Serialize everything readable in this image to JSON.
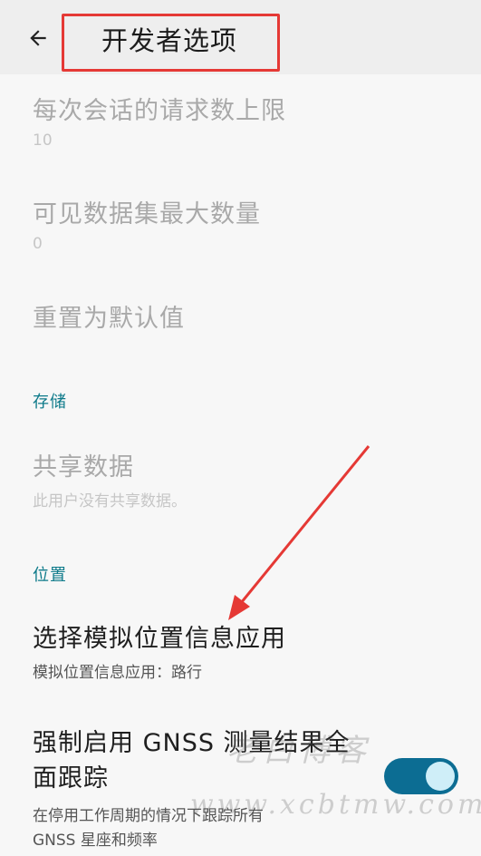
{
  "appbar": {
    "title": "开发者选项",
    "back_icon": "arrow-back-icon"
  },
  "items": {
    "max_requests": {
      "title": "每次会话的请求数上限",
      "summary": "10"
    },
    "max_datasets": {
      "title": "可见数据集最大数量",
      "summary": "0"
    },
    "reset_defaults": {
      "title": "重置为默认值"
    },
    "storage_category": "存储",
    "shared_data": {
      "title": "共享数据",
      "summary": "此用户没有共享数据。"
    },
    "location_category": "位置",
    "mock_location": {
      "title": "选择模拟位置信息应用",
      "summary": "模拟位置信息应用：路行"
    },
    "gnss": {
      "title_line1": "强制启用 GNSS 测量结果全",
      "title_line2": "面跟踪",
      "summary_line1": "在停用工作周期的情况下跟踪所有",
      "summary_line2": "GNSS 星座和频率",
      "enabled": true
    }
  },
  "watermark": {
    "line1": "老白博客",
    "line2": "www.xcbtmw.com"
  },
  "colors": {
    "accent": "#0d7a8a",
    "toggle_track": "#0c6d93",
    "annotation": "#e53935"
  }
}
